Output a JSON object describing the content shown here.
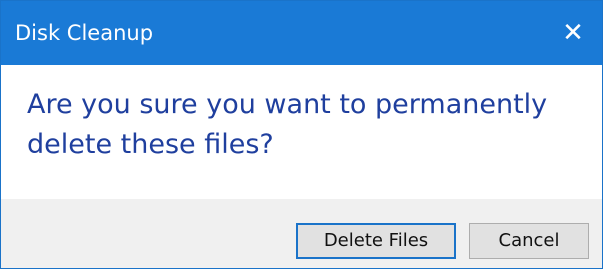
{
  "window": {
    "title": "Disk Cleanup",
    "close_glyph": "✕"
  },
  "dialog": {
    "message": "Are you sure you want to permanently delete these files?"
  },
  "buttons": {
    "delete_label": "Delete Files",
    "cancel_label": "Cancel"
  },
  "colors": {
    "titlebar": "#1a7ad6",
    "message_text": "#1f3f9e",
    "primary_button_border": "#1a73c9"
  }
}
